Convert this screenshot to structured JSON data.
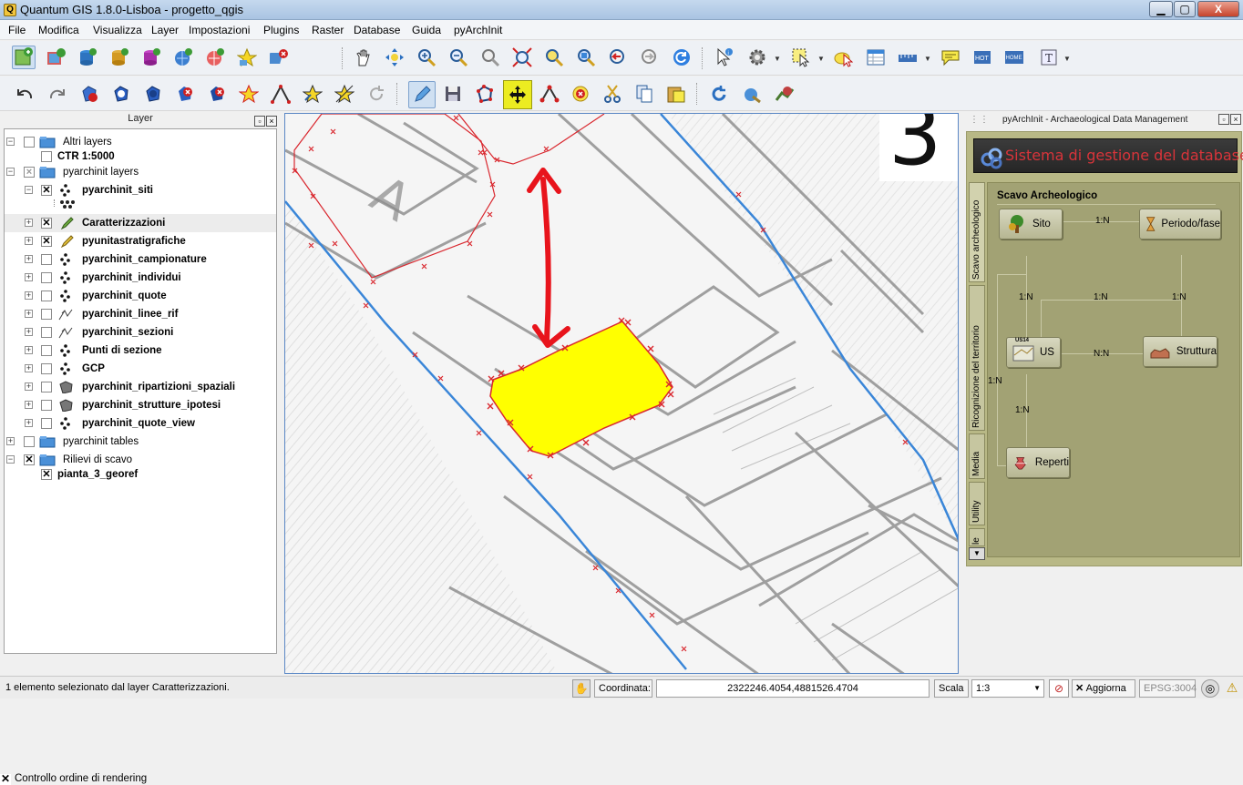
{
  "window": {
    "title": "Quantum GIS 1.8.0-Lisboa - progetto_qgis",
    "minimize": "▁",
    "maximize": "▢",
    "close": "X"
  },
  "menu": [
    "File",
    "Modifica",
    "Visualizza",
    "Layer",
    "Impostazioni",
    "Plugins",
    "Raster",
    "Database",
    "Guida",
    "pyArchInit"
  ],
  "layer_panel": {
    "title": "Layer",
    "rows": [
      {
        "label": "Altri layers",
        "bold": false,
        "checked": false
      },
      {
        "label": "CTR 1:5000",
        "bold": true,
        "checked": false
      },
      {
        "label": "pyarchinit layers",
        "bold": false,
        "checked": "partial"
      },
      {
        "label": "pyarchinit_siti",
        "bold": true,
        "checked": true
      },
      {
        "label": "Caratterizzazioni",
        "bold": true,
        "checked": true
      },
      {
        "label": "pyunitastratigrafiche",
        "bold": true,
        "checked": true
      },
      {
        "label": "pyarchinit_campionature",
        "bold": true,
        "checked": false
      },
      {
        "label": "pyarchinit_individui",
        "bold": true,
        "checked": false
      },
      {
        "label": "pyarchinit_quote",
        "bold": true,
        "checked": false
      },
      {
        "label": "pyarchinit_linee_rif",
        "bold": true,
        "checked": false
      },
      {
        "label": "pyarchinit_sezioni",
        "bold": true,
        "checked": false
      },
      {
        "label": "Punti di sezione",
        "bold": true,
        "checked": false
      },
      {
        "label": "GCP",
        "bold": true,
        "checked": false
      },
      {
        "label": "pyarchinit_ripartizioni_spaziali",
        "bold": true,
        "checked": false
      },
      {
        "label": "pyarchinit_strutture_ipotesi",
        "bold": true,
        "checked": false
      },
      {
        "label": "pyarchinit_quote_view",
        "bold": true,
        "checked": false
      },
      {
        "label": "pyarchinit tables",
        "bold": false,
        "checked": false
      },
      {
        "label": "Rilievi di scavo",
        "bold": false,
        "checked": true
      },
      {
        "label": "pianta_3_georef",
        "bold": true,
        "checked": true
      }
    ],
    "render_order": "Controllo ordine di rendering"
  },
  "map": {
    "corner_label": "3"
  },
  "archinit": {
    "panel_title": "pyArchInit - Archaeological Data Management",
    "banner": "Sistema di gestione del database",
    "section": "Scavo Archeologico",
    "tabs": [
      "Scavo archeologico",
      "Ricognizione del territorio",
      "Media",
      "Utility",
      "le"
    ],
    "nodes": {
      "sito": "Sito",
      "periodo": "Periodo/fase",
      "us": "US",
      "struttura": "Struttura",
      "reperti": "Reperti",
      "us_icon": "US14"
    },
    "relations": {
      "sito_periodo": "1:N",
      "sito_us": "1:N",
      "us_periodo": "1:N",
      "periodo_struttura": "1:N",
      "us_struttura": "N:N",
      "us_self": "1:N",
      "us_reperti": "1:N"
    }
  },
  "status": {
    "message": "1 elemento selezionato dal layer Caratterizzazioni.",
    "coord_label": "Coordinata:",
    "coord_value": "2322246.4054,4881526.4704",
    "scale_label": "Scala",
    "scale_value": "1:3",
    "refresh_label": "Aggiorna",
    "epsg": "EPSG:3004"
  },
  "colors": {
    "selected_feature": "#ffff00",
    "vertex": "#d9272e",
    "edit_line": "#3a86d8",
    "arrow": "#e8141c",
    "banner_text": "#d8343a"
  }
}
